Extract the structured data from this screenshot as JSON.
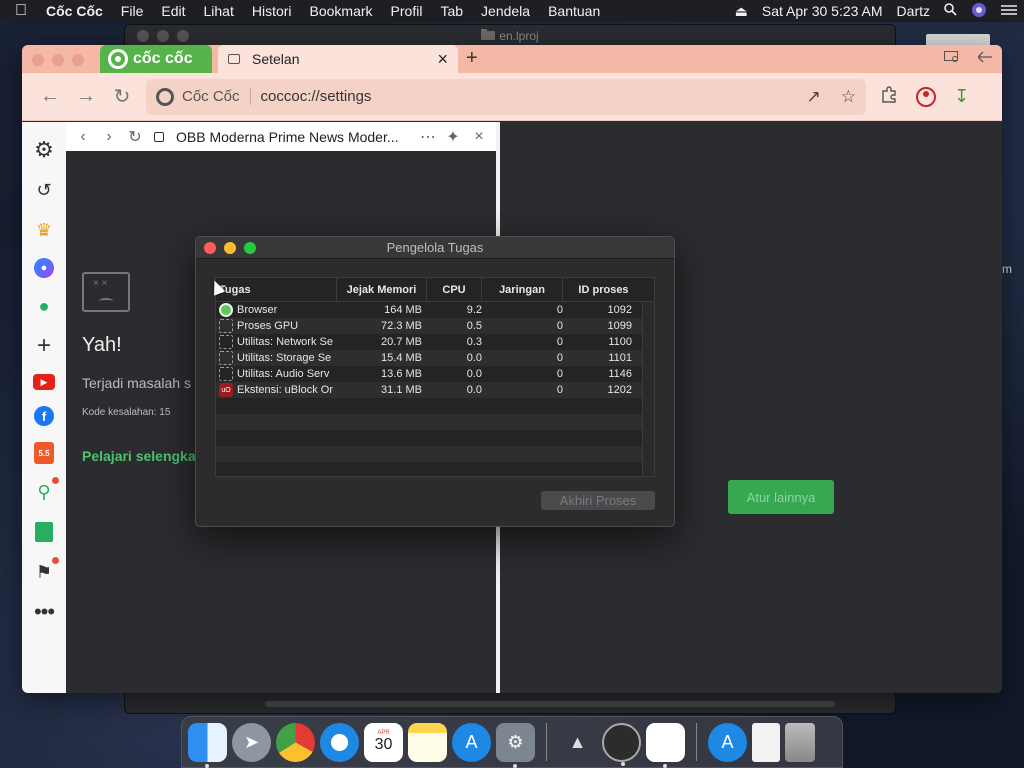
{
  "menubar": {
    "apple": "",
    "app_name": "Cốc Cốc",
    "items": [
      "File",
      "Edit",
      "Lihat",
      "Histori",
      "Bookmark",
      "Profil",
      "Tab",
      "Jendela",
      "Bantuan"
    ],
    "eject": "⏏",
    "datetime": "Sat Apr 30  5:23 AM",
    "user": "Dartz"
  },
  "background_window": {
    "title": "en.lproj",
    "right_edge_text": "m"
  },
  "browser": {
    "logo_text": "cốc cốc",
    "tab": {
      "title": "Setelan",
      "close": "×"
    },
    "new_tab": "+",
    "omnibox": {
      "site_name": "Cốc Cốc",
      "url": "coccoc://settings"
    }
  },
  "sidepanel": {
    "title": "OBB Moderna Prime News Moder...",
    "error": {
      "title": "Yah!",
      "message": "Terjadi masalah s",
      "code": "Kode kesalahan: 15",
      "link": "Pelajari selengka"
    }
  },
  "main": {
    "button_label": "Atur lainnya"
  },
  "task_manager": {
    "title": "Pengelola Tugas",
    "columns": [
      "Tugas",
      "Jejak Memori",
      "CPU",
      "Jaringan",
      "ID proses"
    ],
    "rows": [
      {
        "icon": "coccoc-icon",
        "task": "Browser",
        "memory": "164 MB",
        "cpu": "9.2",
        "network": "0",
        "pid": "1092"
      },
      {
        "icon": "puzzle-icon",
        "task": "Proses GPU",
        "memory": "72.3 MB",
        "cpu": "0.5",
        "network": "0",
        "pid": "1099"
      },
      {
        "icon": "puzzle-icon",
        "task": "Utilitas: Network Se",
        "memory": "20.7 MB",
        "cpu": "0.3",
        "network": "0",
        "pid": "1100"
      },
      {
        "icon": "puzzle-icon",
        "task": "Utilitas: Storage Se",
        "memory": "15.4 MB",
        "cpu": "0.0",
        "network": "0",
        "pid": "1101"
      },
      {
        "icon": "puzzle-icon",
        "task": "Utilitas: Audio Serv",
        "memory": "13.6 MB",
        "cpu": "0.0",
        "network": "0",
        "pid": "1146"
      },
      {
        "icon": "ublock-icon",
        "task": "Ekstensi: uBlock Or",
        "memory": "31.1 MB",
        "cpu": "0.0",
        "network": "0",
        "pid": "1202"
      }
    ],
    "end_process_label": "Akhiri Proses"
  },
  "dock": {
    "calendar_month": "APR",
    "calendar_day": "30",
    "apps": [
      "finder",
      "launchpad",
      "chrome",
      "safari",
      "calendar",
      "notes",
      "app-store",
      "system-preferences",
      "instruments",
      "clock",
      "coccoc",
      "app-store",
      "file",
      "trash"
    ]
  },
  "colors": {
    "accent_green": "#35a851",
    "tabstrip": "#f5b8a6",
    "toolbar": "#fbe3db",
    "dialog_bg": "#2c2c2e"
  }
}
